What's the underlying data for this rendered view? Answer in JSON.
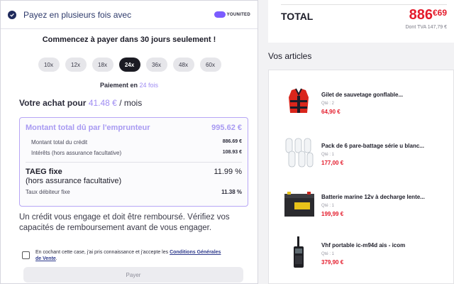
{
  "left": {
    "header_title": "Payez en plusieurs fois avec",
    "brand": "YOUNITED",
    "start_text": "Commencez à payer dans 30 jours seulement !",
    "installments": [
      "10x",
      "12x",
      "18x",
      "24x",
      "36x",
      "48x",
      "60x"
    ],
    "selected_installment": "24x",
    "payment_prefix": "Paiement en",
    "payment_count": "24",
    "payment_suffix": "fois",
    "monthly_prefix": "Votre achat pour",
    "monthly_amount": "41.48 €",
    "monthly_suffix": "/ mois",
    "summary": {
      "total_label": "Montant total dû par l'emprunteur",
      "total_value": "995.62 €",
      "credit_label": "Montant total du crédit",
      "credit_value": "886.69 €",
      "interest_label": "Intérêts (hors assurance facultative)",
      "interest_value": "108.93 €",
      "taeg_label": "TAEG fixe",
      "taeg_sub": "(hors assurance facultative)",
      "taeg_value": "11.99 %",
      "rate_label": "Taux débiteur fixe",
      "rate_value": "11.38 %"
    },
    "warning": "Un crédit vous engage et doit être remboursé. Vérifiez vos capacités de remboursement avant de vous engager.",
    "cgv_text": "En cochant cette case, j'ai pris connaissance et j'accepte les",
    "cgv_link": "Conditions Générales de Vente",
    "cgv_end": ".",
    "pay_button": "Payer"
  },
  "right": {
    "total_label": "TOTAL",
    "total_int": "886",
    "total_dec": "€69",
    "tva": "Dont TVA 147,79 €",
    "articles_title": "Vos articles",
    "items": [
      {
        "name": "Gilet de sauvetage gonflable...",
        "qty": "Qté : 2",
        "price": "64,90 €",
        "icon": "life-vest-image"
      },
      {
        "name": "Pack de 6 pare-battage série u blanc...",
        "qty": "Qté : 1",
        "price": "177,00 €",
        "icon": "fenders-image"
      },
      {
        "name": "Batterie marine 12v à decharge lente...",
        "qty": "Qté : 1",
        "price": "199,99 €",
        "icon": "battery-image"
      },
      {
        "name": "Vhf portable ic-m94d ais - icom",
        "qty": "Qté : 1",
        "price": "379,90 €",
        "icon": "radio-image"
      }
    ]
  },
  "colors": {
    "accent": "#9f8cf3",
    "price_red": "#e41b2b",
    "dark": "#1b1b23"
  }
}
